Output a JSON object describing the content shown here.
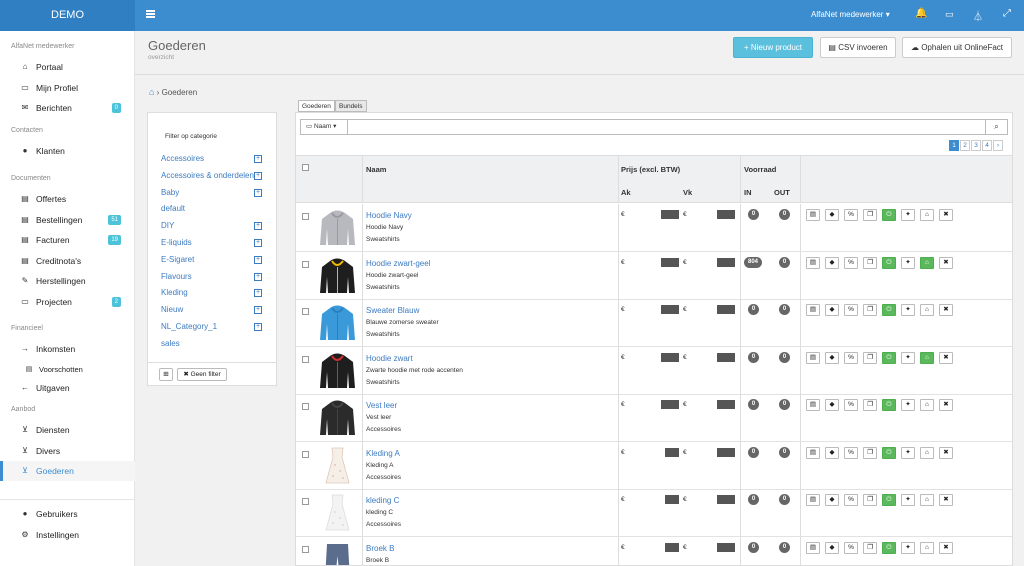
{
  "topbar": {
    "brand": "DEMO",
    "user": "AlfaNet medewerker ▾"
  },
  "sidebar": {
    "sections": [
      {
        "title": "AlfaNet medewerker",
        "items": [
          {
            "label": "Portaal",
            "icon": "home-icon",
            "glyph": "⌂"
          },
          {
            "label": "Mijn Profiel",
            "icon": "id-card-icon",
            "glyph": "▭"
          },
          {
            "label": "Berichten",
            "icon": "comments-icon",
            "glyph": "✉",
            "badge": "0"
          }
        ]
      },
      {
        "title": "Contacten",
        "items": [
          {
            "label": "Klanten",
            "icon": "user-icon",
            "glyph": "●"
          }
        ]
      },
      {
        "title": "Documenten",
        "items": [
          {
            "label": "Offertes",
            "icon": "inbox-icon",
            "glyph": "▤"
          },
          {
            "label": "Bestellingen",
            "icon": "inbox-icon",
            "glyph": "▤",
            "badge": "51"
          },
          {
            "label": "Facturen",
            "icon": "inbox-icon",
            "glyph": "▤",
            "badge": "19"
          },
          {
            "label": "Creditnota's",
            "icon": "inbox-icon",
            "glyph": "▤"
          },
          {
            "label": "Herstellingen",
            "icon": "wrench-icon",
            "glyph": "✎"
          },
          {
            "label": "Projecten",
            "icon": "folder-icon",
            "glyph": "▭",
            "badge": "2"
          }
        ]
      },
      {
        "title": "Financieel",
        "items": [
          {
            "label": "Inkomsten",
            "icon": "arrow-right-icon",
            "glyph": "→"
          },
          {
            "label": "Voorschotten",
            "icon": "inbox-icon",
            "glyph": "▤",
            "sub": true
          },
          {
            "label": "Uitgaven",
            "icon": "arrow-left-icon",
            "glyph": "←"
          }
        ]
      },
      {
        "title": "Aanbod",
        "items": [
          {
            "label": "Diensten",
            "icon": "cart-icon",
            "glyph": "⊻"
          },
          {
            "label": "Divers",
            "icon": "cart-icon",
            "glyph": "⊻"
          },
          {
            "label": "Goederen",
            "icon": "cart-icon",
            "glyph": "⊻",
            "active": true
          }
        ]
      },
      {
        "title": "",
        "items": [
          {
            "label": "Gebruikers",
            "icon": "user-icon",
            "glyph": "●"
          },
          {
            "label": "Instellingen",
            "icon": "gear-icon",
            "glyph": "⚙"
          }
        ]
      }
    ]
  },
  "page": {
    "title": "Goederen",
    "subtitle": "overzicht"
  },
  "buttons": {
    "new": "+ Nieuw product",
    "csv": "CSV invoeren",
    "import": "Ophalen uit OnlineFact"
  },
  "breadcrumb": {
    "current": "Goederen"
  },
  "filter": {
    "title": "Filter op categorie",
    "items": [
      {
        "label": "Accessoires",
        "expand": true
      },
      {
        "label": "Accessoires & onderdelen",
        "expand": true
      },
      {
        "label": "Baby",
        "expand": true
      },
      {
        "label": "default",
        "expand": false
      },
      {
        "label": "DIY",
        "expand": true
      },
      {
        "label": "E-liquids",
        "expand": true
      },
      {
        "label": "E-Sigaret",
        "expand": true
      },
      {
        "label": "Flavours",
        "expand": true
      },
      {
        "label": "Kleding",
        "expand": true
      },
      {
        "label": "Nieuw",
        "expand": true
      },
      {
        "label": "NL_Category_1",
        "expand": true
      },
      {
        "label": "sales",
        "expand": false
      }
    ],
    "expand_symbol": "+",
    "expand_all_symbol": "⊞",
    "clear_label": "✖ Geen filter"
  },
  "tabs": [
    "Goederen",
    "Bundels"
  ],
  "search": {
    "sort_label": "▭ Naam ▾",
    "placeholder": ""
  },
  "pagination": [
    "1",
    "2",
    "3",
    "4",
    "›"
  ],
  "table": {
    "headers": {
      "name": "Naam",
      "price": "Prijs (excl. BTW)",
      "stock": "Voorraad",
      "ak": "Ak",
      "vk": "Vk",
      "in": "IN",
      "out": "OUT"
    },
    "currency": "€",
    "actions": [
      {
        "icon": "inbox-icon",
        "glyph": "▤"
      },
      {
        "icon": "tag-icon",
        "glyph": "◆"
      },
      {
        "icon": "percent-icon",
        "glyph": "%"
      },
      {
        "icon": "copy-icon",
        "glyph": "❐"
      },
      {
        "icon": "power-icon",
        "glyph": "⏻",
        "green": true
      },
      {
        "icon": "pin-icon",
        "glyph": "✦"
      },
      {
        "icon": "home-icon",
        "glyph": "⌂"
      },
      {
        "icon": "close-icon",
        "glyph": "✖"
      }
    ],
    "rows": [
      {
        "name": "Hoodie Navy",
        "desc": "Hoodie Navy",
        "cat": "Sweatshirts",
        "in": "0",
        "out": "0",
        "thumb": "hoodie-grey-image",
        "color": "#b8b8bf",
        "trim": "#9a9aa2",
        "shop": false
      },
      {
        "name": "Hoodie zwart-geel",
        "desc": "Hoodie zwart-geel",
        "cat": "Sweatshirts",
        "in": "804",
        "out": "0",
        "thumb": "hoodie-black-yellow-image",
        "color": "#1e1e1e",
        "trim": "#f2b705",
        "shop": true
      },
      {
        "name": "Sweater Blauw",
        "desc": "Blauwe zomerse sweater",
        "cat": "Sweatshirts",
        "in": "0",
        "out": "0",
        "thumb": "hoodie-blue-image",
        "color": "#3a9ad9",
        "trim": "#2a7fbf",
        "shop": false
      },
      {
        "name": "Hoodie zwart",
        "desc": "Zwarte hoodie met rode accenten",
        "cat": "Sweatshirts",
        "in": "0",
        "out": "0",
        "thumb": "hoodie-black-red-image",
        "color": "#1e1e1e",
        "trim": "#d32f2f",
        "shop": true
      },
      {
        "name": "Vest leer",
        "desc": "Vest leer",
        "cat": "Accessoires",
        "in": "0",
        "out": "0",
        "thumb": "leather-jacket-image",
        "color": "#2b2b2b",
        "trim": "#444",
        "shop": false
      },
      {
        "name": "Kleding A",
        "desc": "Kleding A",
        "cat": "Accessoires",
        "in": "0",
        "out": "0",
        "thumb": "dress-image",
        "color": "#f5efe8",
        "trim": "#e0c8b8",
        "shop": false
      },
      {
        "name": "kleding C",
        "desc": "kleding C",
        "cat": "Accessoires",
        "in": "0",
        "out": "0",
        "thumb": "dress-image",
        "color": "#f3f3f3",
        "trim": "#ddd",
        "shop": false
      },
      {
        "name": "Broek B",
        "desc": "Broek B",
        "cat": "",
        "in": "0",
        "out": "0",
        "thumb": "pants-image",
        "color": "#5a6d8c",
        "trim": "#48587a",
        "shop": false
      }
    ]
  }
}
